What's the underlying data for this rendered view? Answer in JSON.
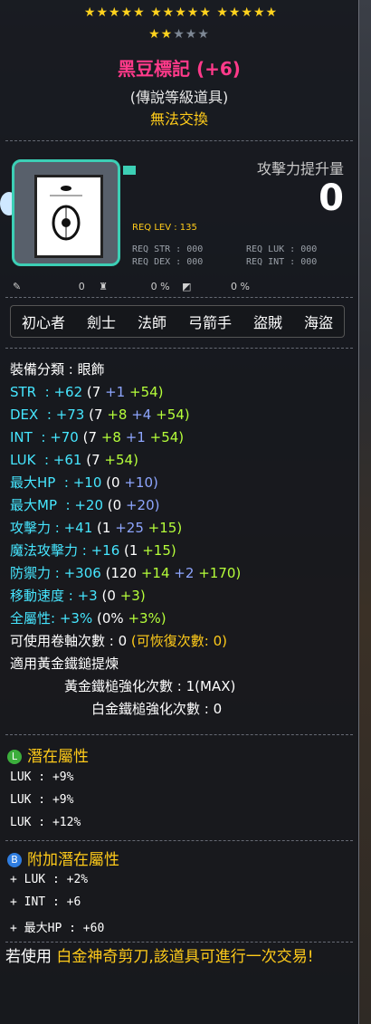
{
  "stars": {
    "row1": "★★★★★ ★★★★★ ★★★★★",
    "row2_on": "★★",
    "row2_off": "★★★"
  },
  "item": {
    "name": "黑豆標記 (+6)",
    "grade": "(傳說等級道具)",
    "trade": "無法交換"
  },
  "attack_boost": {
    "label": "攻擊力提升量",
    "value": "0"
  },
  "requirements": {
    "lev": "REQ LEV : 135",
    "str": "REQ STR : 000",
    "luk": "REQ LUK : 000",
    "dex": "REQ DEX : 000",
    "int": "REQ INT : 000"
  },
  "small_values": {
    "a": "0",
    "b": "0 %",
    "c": "0 %"
  },
  "jobs": [
    "初心者",
    "劍士",
    "法師",
    "弓箭手",
    "盜賊",
    "海盜"
  ],
  "stats": {
    "category": "裝備分類 : 眼飾",
    "str": {
      "name": "STR  :",
      "total": "+62",
      "base": "(7",
      "a": "+1",
      "b": "+54)"
    },
    "dex": {
      "name": "DEX  :",
      "total": "+73",
      "base": "(7",
      "a": "+8",
      "b": "+4",
      "c": "+54)"
    },
    "int": {
      "name": "INT  :",
      "total": "+70",
      "base": "(7",
      "a": "+8",
      "b": "+1",
      "c": "+54)"
    },
    "luk": {
      "name": "LUK  :",
      "total": "+61",
      "base": "(7",
      "a": "+54)"
    },
    "hp": {
      "name": "最大HP  :",
      "total": "+10",
      "base": "(0",
      "a": "+10)"
    },
    "mp": {
      "name": "最大MP  :",
      "total": "+20",
      "base": "(0",
      "a": "+20)"
    },
    "atk": {
      "name": "攻擊力 :",
      "total": "+41",
      "base": "(1",
      "a": "+25",
      "b": "+15)"
    },
    "matk": {
      "name": "魔法攻擊力 :",
      "total": "+16",
      "base": "(1",
      "a": "+15)"
    },
    "def": {
      "name": "防禦力 :",
      "total": "+306",
      "base": "(120",
      "a": "+14",
      "b": "+2",
      "c": "+170)"
    },
    "speed": {
      "name": "移動速度 :",
      "total": "+3",
      "base": "(0",
      "a": "+3)"
    },
    "all": {
      "name": "全屬性:",
      "total": "+3%",
      "base": "(0%",
      "a": "+3%)"
    },
    "scroll": {
      "text": "可使用卷軸次數 : 0",
      "recover": "(可恢復次數: 0)"
    },
    "gold_hammer": "適用黃金鐵鎚提煉",
    "gold_count": "黃金鐵槌強化次數 : 1(MAX)",
    "plat_count": "白金鐵槌強化次數 : 0"
  },
  "potential": {
    "badge": "L",
    "title": "潛在屬性",
    "lines": [
      "LUK : +9%",
      "LUK : +9%",
      "LUK : +12%"
    ]
  },
  "bonus": {
    "badge": "B",
    "title": "附加潛在屬性",
    "lines": [
      "+ LUK : +2%",
      "+ INT : +6",
      "+ 最大HP : +60"
    ]
  },
  "footer": {
    "pre": "若使用 ",
    "highlight": "白金神奇剪刀,該道具可進行一次交易!"
  },
  "colors": {
    "name": "#ff3a8a",
    "yellow": "#ffcb1a",
    "green": "#b6ff3a",
    "blue": "#8ea6ff",
    "cyan": "#46e6ff",
    "legend_badge": "#3cae3c",
    "bonus_badge": "#2f7de0"
  }
}
